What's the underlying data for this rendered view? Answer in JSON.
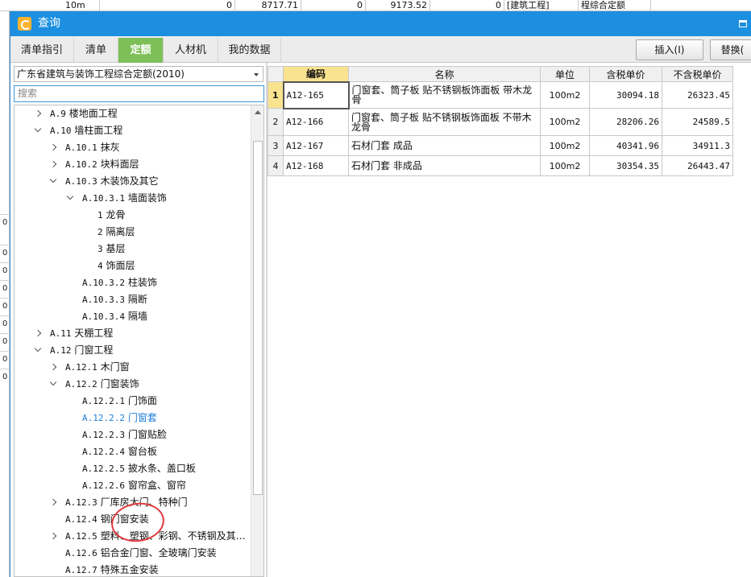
{
  "background": {
    "row": [
      "10m",
      "0",
      "8717.71",
      "0",
      "9173.52",
      "0",
      "[建筑工程]",
      "程综合定额"
    ],
    "left_marks": [
      "0",
      "0",
      "0",
      "0",
      "0",
      "0",
      "0",
      "0",
      "0"
    ]
  },
  "window": {
    "title": "查询"
  },
  "tabs": [
    {
      "label": "清单指引"
    },
    {
      "label": "清单"
    },
    {
      "label": "定额"
    },
    {
      "label": "人材机"
    },
    {
      "label": "我的数据"
    }
  ],
  "toolbar": {
    "insert_label": "插入(I)",
    "replace_label": "替换("
  },
  "left_panel": {
    "library_select": "广东省建筑与装饰工程综合定额(2010)",
    "search_placeholder": "搜索"
  },
  "tree": [
    {
      "code": "A.9",
      "label": "楼地面工程"
    },
    {
      "code": "A.10",
      "label": "墙柱面工程"
    },
    {
      "code": "A.10.1",
      "label": "抹灰"
    },
    {
      "code": "A.10.2",
      "label": "块料面层"
    },
    {
      "code": "A.10.3",
      "label": "木装饰及其它"
    },
    {
      "code": "A.10.3.1",
      "label": "墙面装饰"
    },
    {
      "code": "1",
      "label": "龙骨"
    },
    {
      "code": "2",
      "label": "隔离层"
    },
    {
      "code": "3",
      "label": "基层"
    },
    {
      "code": "4",
      "label": "饰面层"
    },
    {
      "code": "A.10.3.2",
      "label": "柱装饰"
    },
    {
      "code": "A.10.3.3",
      "label": "隔断"
    },
    {
      "code": "A.10.3.4",
      "label": "隔墙"
    },
    {
      "code": "A.11",
      "label": "天棚工程"
    },
    {
      "code": "A.12",
      "label": "门窗工程"
    },
    {
      "code": "A.12.1",
      "label": "木门窗"
    },
    {
      "code": "A.12.2",
      "label": "门窗装饰"
    },
    {
      "code": "A.12.2.1",
      "label": "门饰面"
    },
    {
      "code": "A.12.2.2",
      "label": "门窗套"
    },
    {
      "code": "A.12.2.3",
      "label": "门窗贴脸"
    },
    {
      "code": "A.12.2.4",
      "label": "窗台板"
    },
    {
      "code": "A.12.2.5",
      "label": "披水条、盖口板"
    },
    {
      "code": "A.12.2.6",
      "label": "窗帘盒、窗帘"
    },
    {
      "code": "A.12.3",
      "label": "厂库房大门、特种门"
    },
    {
      "code": "A.12.4",
      "label": "钢门窗安装"
    },
    {
      "code": "A.12.5",
      "label": "塑料、塑钢、彩钢、不锈钢及其…"
    },
    {
      "code": "A.12.6",
      "label": "铝合金门窗、全玻璃门安装"
    },
    {
      "code": "A.12.7",
      "label": "特殊五金安装"
    }
  ],
  "table": {
    "columns": [
      "编码",
      "名称",
      "单位",
      "含税单价",
      "不含税单价"
    ],
    "rows": [
      {
        "index": "1",
        "code": "A12-165",
        "name": "门窗套、筒子板 贴不锈钢板饰面板 带木龙骨",
        "unit": "100m2",
        "price_tax": "30094.18",
        "price_notax": "26323.45"
      },
      {
        "index": "2",
        "code": "A12-166",
        "name": "门窗套、筒子板 贴不锈钢板饰面板 不带木龙骨",
        "unit": "100m2",
        "price_tax": "28206.26",
        "price_notax": "24589.5"
      },
      {
        "index": "3",
        "code": "A12-167",
        "name": "石材门套 成品",
        "unit": "100m2",
        "price_tax": "40341.96",
        "price_notax": "34911.3"
      },
      {
        "index": "4",
        "code": "A12-168",
        "name": "石材门套 非成品",
        "unit": "100m2",
        "price_tax": "30354.35",
        "price_notax": "26443.47"
      }
    ]
  },
  "colors": {
    "titlebar": "#1c8fe0",
    "active_tab": "#7dbf58",
    "highlight": "#fae38f",
    "selected_node": "#1f7fd6",
    "annotation_circle": "#e0393e"
  }
}
